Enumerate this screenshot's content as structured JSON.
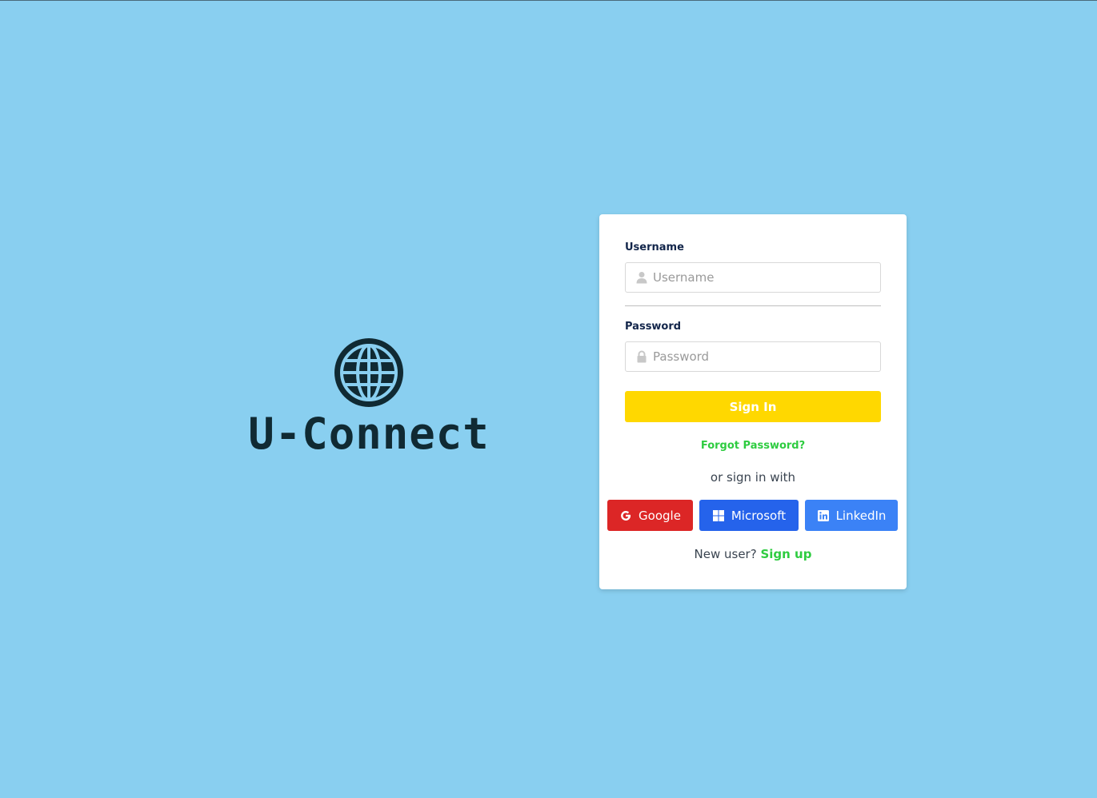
{
  "brand": {
    "name": "U-Connect",
    "logo_icon": "globe-icon"
  },
  "form": {
    "username_label": "Username",
    "username_placeholder": "Username",
    "username_value": "",
    "username_icon": "user-icon",
    "password_label": "Password",
    "password_placeholder": "Password",
    "password_value": "",
    "password_icon": "lock-icon",
    "signin_label": "Sign In",
    "forgot_label": "Forgot Password?",
    "or_label": "or sign in with",
    "social": {
      "google_label": "Google",
      "microsoft_label": "Microsoft",
      "linkedin_label": "LinkedIn"
    },
    "new_user_label": "New user?",
    "signup_label": "Sign up"
  },
  "colors": {
    "background": "#89cff0",
    "brand_text": "#102a33",
    "signin_button": "#ffd800",
    "link_green": "#2ecc40",
    "google": "#dc2626",
    "microsoft": "#2563eb",
    "linkedin": "#3b82f6"
  }
}
